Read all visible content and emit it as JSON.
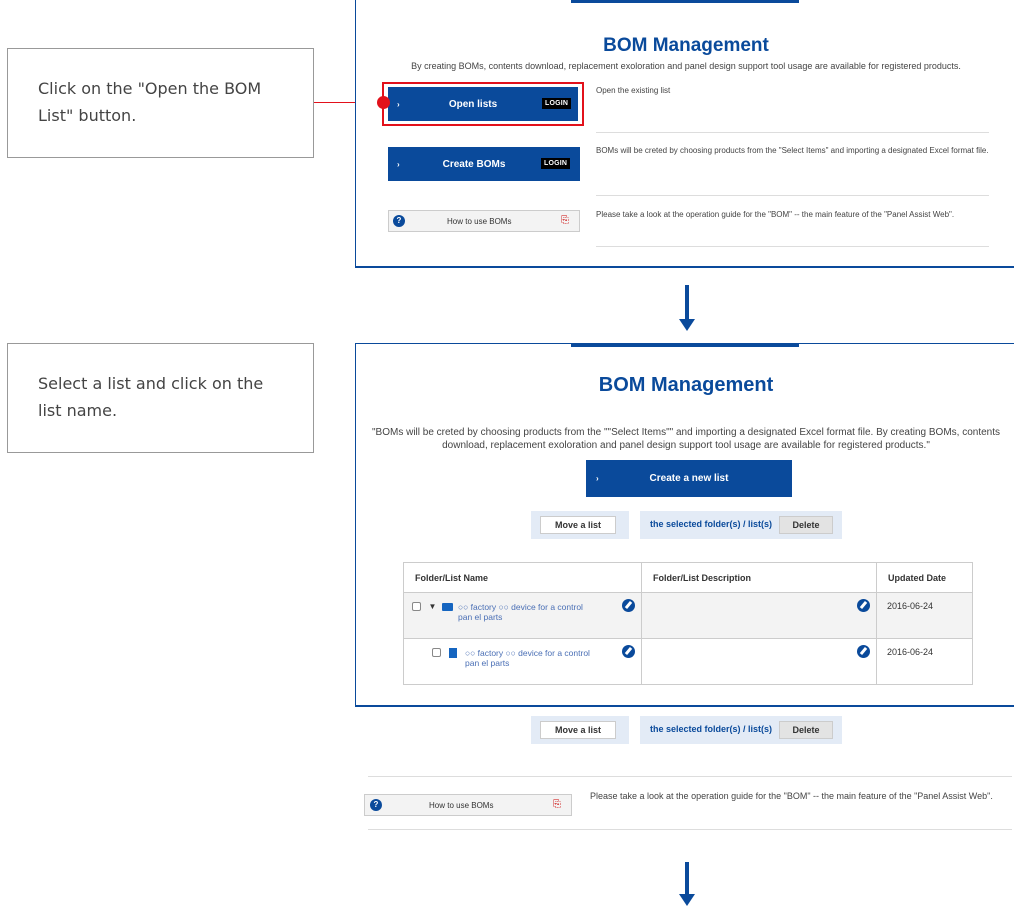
{
  "callouts": {
    "step1": "Click on the \"Open the BOM List\" button.",
    "step2": "Select a list and click on the list name."
  },
  "panel1": {
    "title": "BOM Management",
    "subtitle": "By creating BOMs, contents download, replacement exoloration and panel design support tool usage are available for registered products.",
    "open_lists_label": "Open lists",
    "login_badge": "LOGIN",
    "open_lists_desc": "Open the existing list",
    "create_boms_label": "Create BOMs",
    "create_boms_desc": "BOMs will be creted by choosing products from the \"Select Items\" and importing a designated Excel format file.",
    "howto_label": "How to use BOMs",
    "howto_desc": "Please take a look at the operation guide for the \"BOM\" -- the main feature of the \"Panel Assist Web\"."
  },
  "panel2": {
    "title": "BOM Management",
    "description": "\"BOMs will be creted by choosing products from the \"\"Select Items\"\" and importing a designated Excel format file. By creating BOMs, contents download, replacement exoloration and panel design support tool usage are available for registered products.\"",
    "create_new_label": "Create a new list",
    "move_label": "Move a list",
    "selected_label": "the selected folder(s) / list(s)",
    "delete_label": "Delete",
    "table": {
      "headers": [
        "Folder/List Name",
        "Folder/List Description",
        "Updated Date"
      ],
      "rows": [
        {
          "name": "○○ factory ○○ device for a control pan el parts",
          "description": "",
          "date": "2016-06-24"
        },
        {
          "name": "○○ factory ○○ device for a control pan el parts",
          "description": "",
          "date": "2016-06-24"
        }
      ]
    },
    "howto_label": "How to use BOMs",
    "howto_desc": "Please take a look at the operation guide for the \"BOM\" -- the main feature of the \"Panel Assist Web\"."
  },
  "colors": {
    "brand_blue": "#0a4a9b",
    "highlight_red": "#e2111b"
  },
  "icons": [
    "question-icon",
    "pdf-icon",
    "folder-icon",
    "list-icon",
    "edit-icon",
    "expand-triangle-icon",
    "down-arrow-icon"
  ]
}
